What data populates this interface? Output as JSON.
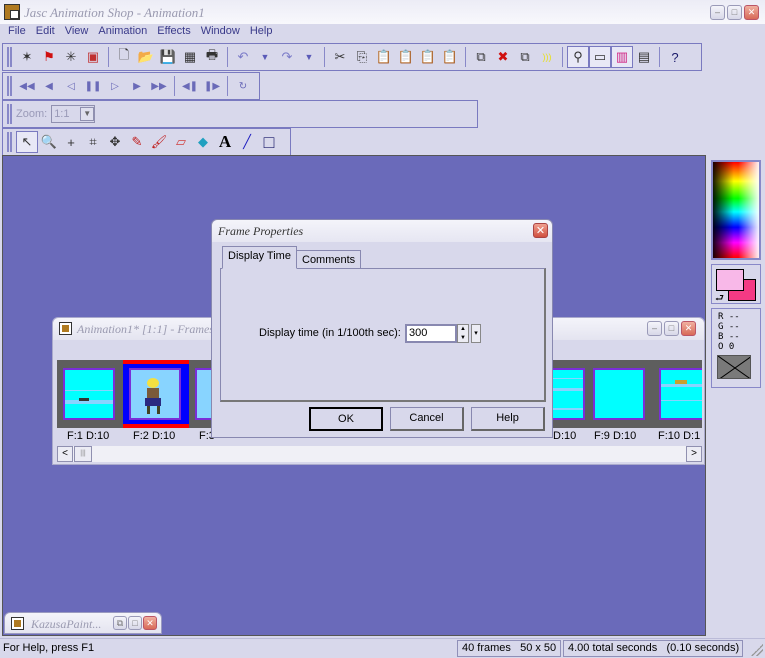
{
  "window": {
    "title": "Jasc Animation Shop - Animation1",
    "buttons": {
      "minimize": "–",
      "maximize": "□",
      "close": "✕"
    }
  },
  "menu": [
    {
      "label": "File"
    },
    {
      "label": "Edit"
    },
    {
      "label": "View"
    },
    {
      "label": "Animation"
    },
    {
      "label": "Effects"
    },
    {
      "label": "Window"
    },
    {
      "label": "Help"
    }
  ],
  "standard_toolbar": [
    {
      "name": "animation-wizard-icon",
      "glyph": "✶"
    },
    {
      "name": "banner-wizard-icon",
      "glyph": "⚑"
    },
    {
      "name": "image-transition-icon",
      "glyph": "✳"
    },
    {
      "name": "image-effect-icon",
      "glyph": "▣"
    },
    {
      "name": "sep"
    },
    {
      "name": "new-icon",
      "glyph": "🗋"
    },
    {
      "name": "open-icon",
      "glyph": "📂"
    },
    {
      "name": "save-icon",
      "glyph": "💾"
    },
    {
      "name": "save-frames-icon",
      "glyph": "▦"
    },
    {
      "name": "print-icon",
      "glyph": "🖶"
    },
    {
      "name": "sep"
    },
    {
      "name": "undo-icon",
      "glyph": "↶"
    },
    {
      "name": "undo-dropdown-icon",
      "glyph": "▼"
    },
    {
      "name": "redo-icon",
      "glyph": "↷"
    },
    {
      "name": "redo-dropdown-icon",
      "glyph": "▼"
    },
    {
      "name": "sep"
    },
    {
      "name": "cut-icon",
      "glyph": "✂"
    },
    {
      "name": "copy-icon",
      "glyph": "⎘"
    },
    {
      "name": "paste-as-new-animation-icon",
      "glyph": "📋"
    },
    {
      "name": "paste-before-icon",
      "glyph": "📋"
    },
    {
      "name": "paste-after-icon",
      "glyph": "📋"
    },
    {
      "name": "paste-into-icon",
      "glyph": "📋"
    },
    {
      "name": "sep"
    },
    {
      "name": "duplicate-icon",
      "glyph": "⧉"
    },
    {
      "name": "delete-frames-icon",
      "glyph": "✖"
    },
    {
      "name": "insert-frames-icon",
      "glyph": "⧉"
    },
    {
      "name": "sound-icon",
      "glyph": ")))"
    },
    {
      "name": "sep"
    },
    {
      "name": "tool-palette-icon",
      "glyph": "⚲",
      "active": true
    },
    {
      "name": "frame-properties-icon",
      "glyph": "▭",
      "active": true
    },
    {
      "name": "color-palette-icon",
      "glyph": "▥",
      "active": true
    },
    {
      "name": "filmstrip-icon",
      "glyph": "▤"
    },
    {
      "name": "sep"
    },
    {
      "name": "context-help-icon",
      "glyph": "?"
    }
  ],
  "playback_toolbar": [
    {
      "name": "first-frame-icon",
      "glyph": "◀◀"
    },
    {
      "name": "previous-frame-icon",
      "glyph": "◀"
    },
    {
      "name": "play-backward-icon",
      "glyph": "◁"
    },
    {
      "name": "pause-icon",
      "glyph": "❚❚"
    },
    {
      "name": "play-forward-icon",
      "glyph": "▷"
    },
    {
      "name": "next-frame-icon",
      "glyph": "▶"
    },
    {
      "name": "last-frame-icon",
      "glyph": "▶▶"
    },
    {
      "name": "sep"
    },
    {
      "name": "step-back-icon",
      "glyph": "◀❚"
    },
    {
      "name": "step-forward-icon",
      "glyph": "❚▶"
    },
    {
      "name": "sep"
    },
    {
      "name": "loop-icon",
      "glyph": "↻"
    }
  ],
  "zoom_toolbar": {
    "label": "Zoom:",
    "value": "1:1"
  },
  "tools": [
    {
      "name": "arrow-tool-icon",
      "glyph": "↖",
      "active": true
    },
    {
      "name": "zoom-tool-icon",
      "glyph": "🔍"
    },
    {
      "name": "mover-tool-icon",
      "glyph": "+"
    },
    {
      "name": "crop-tool-icon",
      "glyph": "⌗"
    },
    {
      "name": "move-tool-icon",
      "glyph": "✥"
    },
    {
      "name": "dropper-tool-icon",
      "glyph": "✎"
    },
    {
      "name": "paintbrush-tool-icon",
      "glyph": "🖌"
    },
    {
      "name": "eraser-tool-icon",
      "glyph": "▱"
    },
    {
      "name": "fill-tool-icon",
      "glyph": "◆"
    },
    {
      "name": "text-tool-icon",
      "glyph": "A"
    },
    {
      "name": "line-tool-icon",
      "glyph": "╱"
    },
    {
      "name": "shape-tool-icon",
      "glyph": "□"
    }
  ],
  "color_panel": {
    "foreground": "#f8b8e8",
    "background": "#f43a84",
    "swap_glyph": "⮐",
    "rgb": [
      "R --",
      "G --",
      "B --",
      "O 0"
    ]
  },
  "frames_window": {
    "title": "Animation1* [1:1] - Frames",
    "frames": [
      {
        "label": "F:1  D:10"
      },
      {
        "label": "F:2  D:10",
        "selected": true
      },
      {
        "label": "F:3"
      },
      {
        "label": "D:10"
      },
      {
        "label": "F:9  D:10"
      },
      {
        "label": "F:10  D:1"
      }
    ],
    "scroll_left": "<",
    "scroll_right": ">",
    "scroll_grip": "|||"
  },
  "dialog": {
    "title": "Frame Properties",
    "close": "✕",
    "tabs": [
      {
        "label": "Display Time",
        "active": true
      },
      {
        "label": "Comments"
      }
    ],
    "field_label": "Display time (in 1/100th sec):",
    "field_value": "300",
    "spin_up": "▲",
    "spin_down": "▼",
    "spin_dd": "▾",
    "buttons": {
      "ok": "OK",
      "cancel": "Cancel",
      "help": "Help"
    }
  },
  "minimized_window": {
    "title": "KazusaPaint..."
  },
  "status": {
    "help": "For Help, press F1",
    "frames": "40 frames   50 x 50",
    "seconds": "4.00 total seconds   (0.10 seconds)"
  }
}
